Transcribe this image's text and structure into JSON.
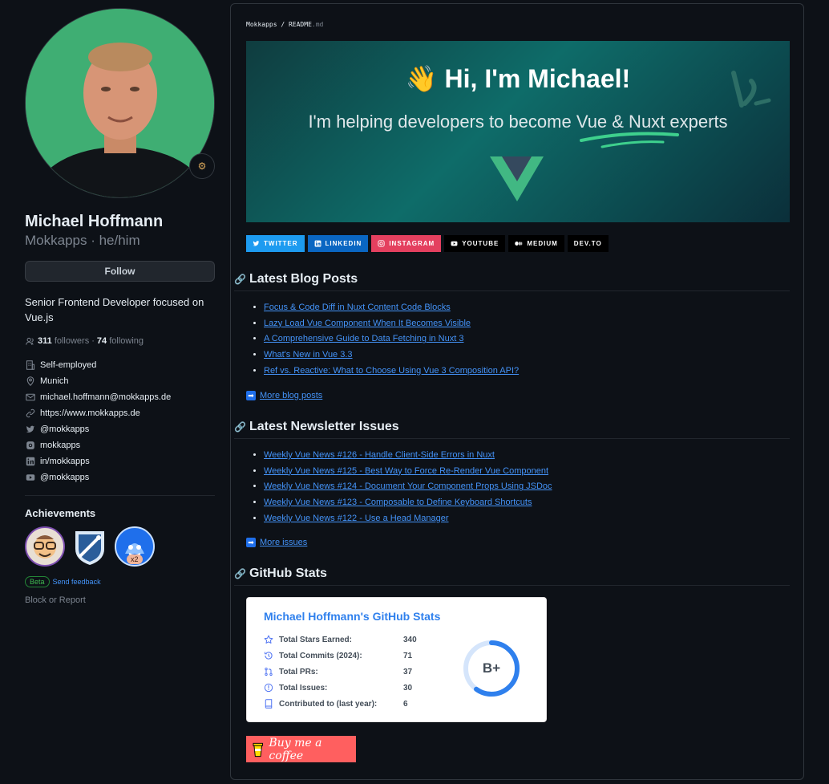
{
  "profile": {
    "name": "Michael Hoffmann",
    "login_pronouns": "Mokkapps · he/him",
    "follow_label": "Follow",
    "bio": "Senior Frontend Developer focused on Vue.js",
    "followers_count": "311",
    "followers_label": "followers",
    "separator": "·",
    "following_count": "74",
    "following_label": "following",
    "details": [
      {
        "icon": "organization-icon",
        "text": "Self-employed"
      },
      {
        "icon": "location-icon",
        "text": "Munich"
      },
      {
        "icon": "mail-icon",
        "text": "michael.hoffmann@mokkapps.de"
      },
      {
        "icon": "link-icon",
        "text": "https://www.mokkapps.de"
      },
      {
        "icon": "twitter-icon",
        "text": "@mokkapps"
      },
      {
        "icon": "instagram-icon",
        "text": "mokkapps"
      },
      {
        "icon": "linkedin-icon",
        "text": "in/mokkapps"
      },
      {
        "icon": "youtube-icon",
        "text": "@mokkapps"
      }
    ],
    "achievements_title": "Achievements",
    "achievement_x2": "x2",
    "beta_label": "Beta",
    "feedback_label": "Send feedback",
    "block_label": "Block or Report"
  },
  "readme": {
    "crumb_user": "Mokkapps",
    "crumb_sep": " / ",
    "crumb_file": "README",
    "crumb_ext": ".md",
    "banner_title": "Hi, I'm Michael!",
    "banner_subtitle": "I'm helping developers to become Vue & Nuxt experts",
    "socials": [
      {
        "label": "TWITTER",
        "icon": "twitter-icon",
        "color": "#1d9bf0"
      },
      {
        "label": "LINKEDIN",
        "icon": "linkedin-icon",
        "color": "#0a66c2"
      },
      {
        "label": "INSTAGRAM",
        "icon": "instagram-icon",
        "color": "#e4405f"
      },
      {
        "label": "YOUTUBE",
        "icon": "youtube-icon",
        "color": "#000000"
      },
      {
        "label": "MEDIUM",
        "icon": "medium-icon",
        "color": "#000000"
      },
      {
        "label": "DEV.TO",
        "icon": "",
        "color": "#000000"
      }
    ],
    "blog_heading": "Latest Blog Posts",
    "blog_posts": [
      "Focus & Code Diff in Nuxt Content Code Blocks",
      "Lazy Load Vue Component When It Becomes Visible",
      "A Comprehensive Guide to Data Fetching in Nuxt 3",
      "What's New in Vue 3.3",
      "Ref vs. Reactive: What to Choose Using Vue 3 Composition API?"
    ],
    "more_blog": "More blog posts",
    "newsletter_heading": "Latest Newsletter Issues",
    "newsletter_issues": [
      "Weekly Vue News #126 - Handle Client-Side Errors in Nuxt",
      "Weekly Vue News #125 - Best Way to Force Re-Render Vue Component",
      "Weekly Vue News #124 - Document Your Component Props Using JSDoc",
      "Weekly Vue News #123 - Composable to Define Keyboard Shortcuts",
      "Weekly Vue News #122 - Use a Head Manager"
    ],
    "more_issues": "More issues",
    "stats_heading": "GitHub Stats",
    "stats_card": {
      "title": "Michael Hoffmann's GitHub Stats",
      "rows": [
        {
          "icon": "star-icon",
          "label": "Total Stars Earned:",
          "value": "340"
        },
        {
          "icon": "history-icon",
          "label": "Total Commits (2024):",
          "value": "71"
        },
        {
          "icon": "pull-request-icon",
          "label": "Total PRs:",
          "value": "37"
        },
        {
          "icon": "issue-icon",
          "label": "Total Issues:",
          "value": "30"
        },
        {
          "icon": "repo-icon",
          "label": "Contributed to (last year):",
          "value": "6"
        }
      ],
      "rank": "B+",
      "rank_progress": 0.6,
      "rank_color": "#2f80ed"
    },
    "coffee_label": "Buy me a coffee"
  }
}
